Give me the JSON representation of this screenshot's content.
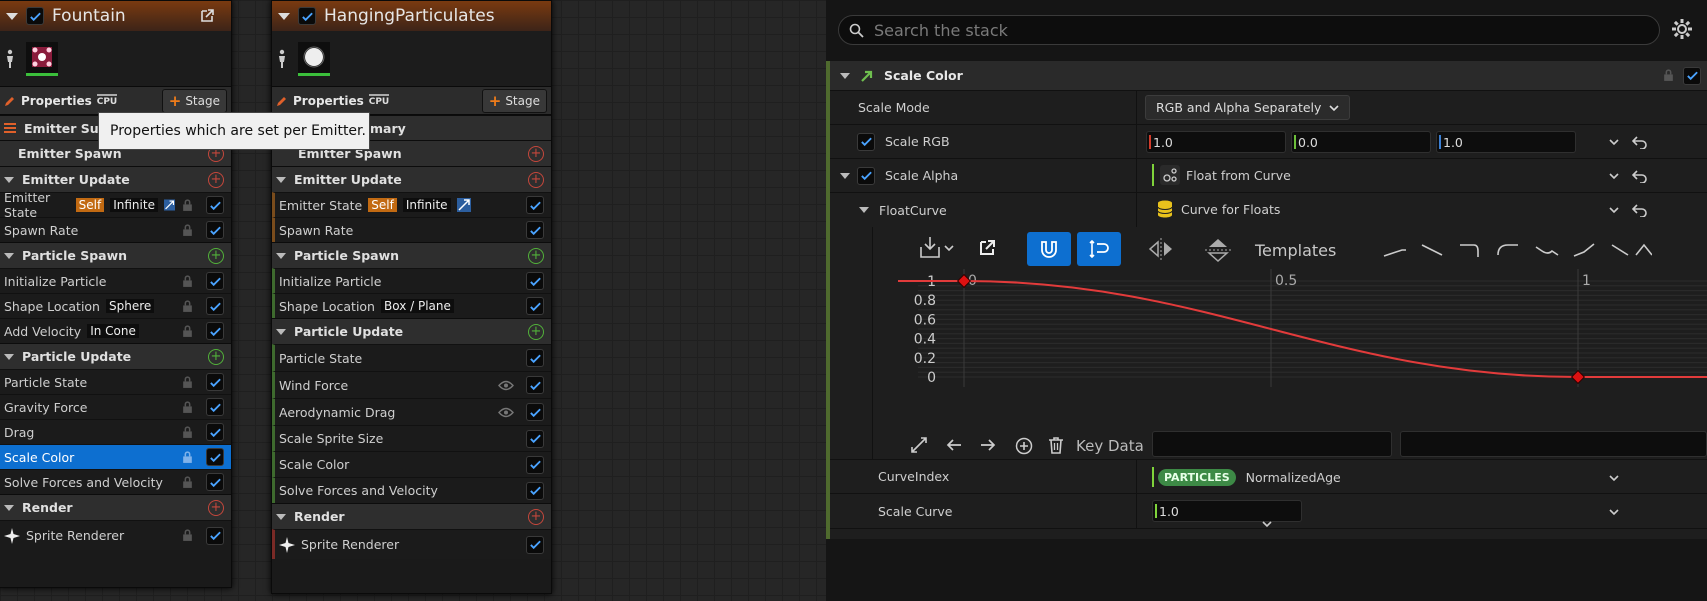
{
  "nodes": [
    {
      "title": "Fountain",
      "properties_label": "Properties",
      "cpu_label": "CPU",
      "stage_label": "Stage",
      "summary_label": "Emitter Summary",
      "sections": [
        {
          "label": "Emitter Spawn",
          "add": "red",
          "rows": []
        },
        {
          "label": "Emitter Update",
          "add": "red",
          "rows": [
            {
              "label": "Emitter State",
              "tags": [
                "Self",
                "Infinite"
              ],
              "scaleIcon": true,
              "lock": true
            }
          ]
        },
        {
          "label": "Spawn Rate",
          "isRow": true
        },
        {
          "label": "Particle Spawn",
          "add": "green",
          "rows": []
        }
      ]
    }
  ],
  "fountain": {
    "title": "Fountain",
    "properties_label": "Properties",
    "cpu_label": "CPU",
    "stage_label": "Stage",
    "summary_label": "Emitter Summ",
    "emitter_spawn": "Emitter Spawn",
    "emitter_update": "Emitter Update",
    "emitter_state": "Emitter State",
    "self_tag": "Self",
    "infinite_tag": "Infinite",
    "spawn_rate": "Spawn Rate",
    "particle_spawn": "Particle Spawn",
    "initialize_particle": "Initialize Particle",
    "shape_location": "Shape Location",
    "shape_value": "Sphere",
    "add_velocity": "Add Velocity",
    "velocity_value": "In Cone",
    "particle_update": "Particle Update",
    "particle_state": "Particle State",
    "gravity_force": "Gravity Force",
    "drag": "Drag",
    "scale_color": "Scale Color",
    "solve_forces": "Solve Forces and Velocity",
    "render": "Render",
    "sprite_renderer": "Sprite Renderer"
  },
  "hanging": {
    "title": "HangingParticulates",
    "properties_label": "Properties",
    "cpu_label": "CPU",
    "stage_label": "Stage",
    "summary_label": "mary",
    "emitter_spawn": "Emitter Spawn",
    "emitter_update": "Emitter Update",
    "emitter_state": "Emitter State",
    "self_tag": "Self",
    "infinite_tag": "Infinite",
    "spawn_rate": "Spawn Rate",
    "particle_spawn": "Particle Spawn",
    "initialize_particle": "Initialize Particle",
    "shape_location": "Shape Location",
    "shape_value": "Box / Plane",
    "particle_update": "Particle Update",
    "particle_state": "Particle State",
    "wind_force": "Wind Force",
    "aerodynamic_drag": "Aerodynamic Drag",
    "scale_sprite_size": "Scale Sprite Size",
    "scale_color": "Scale Color",
    "solve_forces": "Solve Forces and Velocity",
    "render": "Render",
    "sprite_renderer": "Sprite Renderer"
  },
  "tooltip": "Properties which are set per Emitter.",
  "panel": {
    "search_placeholder": "Search the stack",
    "module_title": "Scale Color",
    "scale_mode_label": "Scale Mode",
    "scale_mode_value": "RGB and Alpha Separately",
    "scale_rgb_label": "Scale RGB",
    "rgb_values": [
      "1.0",
      "0.0",
      "1.0"
    ],
    "scale_alpha_label": "Scale Alpha",
    "scale_alpha_value": "Float from Curve",
    "float_curve_label": "FloatCurve",
    "float_curve_value": "Curve for Floats",
    "templates_label": "Templates",
    "key_data_label": "Key Data",
    "curve_index_label": "CurveIndex",
    "curve_index_tag": "PARTICLES",
    "curve_index_value": "NormalizedAge",
    "scale_curve_label": "Scale Curve",
    "scale_curve_value": "1.0"
  },
  "curve": {
    "x_ticks": [
      "0",
      "0.5",
      "1"
    ],
    "y_ticks": [
      "1",
      "0.8",
      "0.6",
      "0.4",
      "0.2",
      "0"
    ],
    "keys": [
      {
        "time": 0,
        "value": 1.0
      },
      {
        "time": 1,
        "value": 0.0
      }
    ],
    "color": "#e23b3b"
  },
  "colors": {
    "accent": "#0d6fd0",
    "selected": "#0d6fd0",
    "curve": "#e23b3b"
  }
}
